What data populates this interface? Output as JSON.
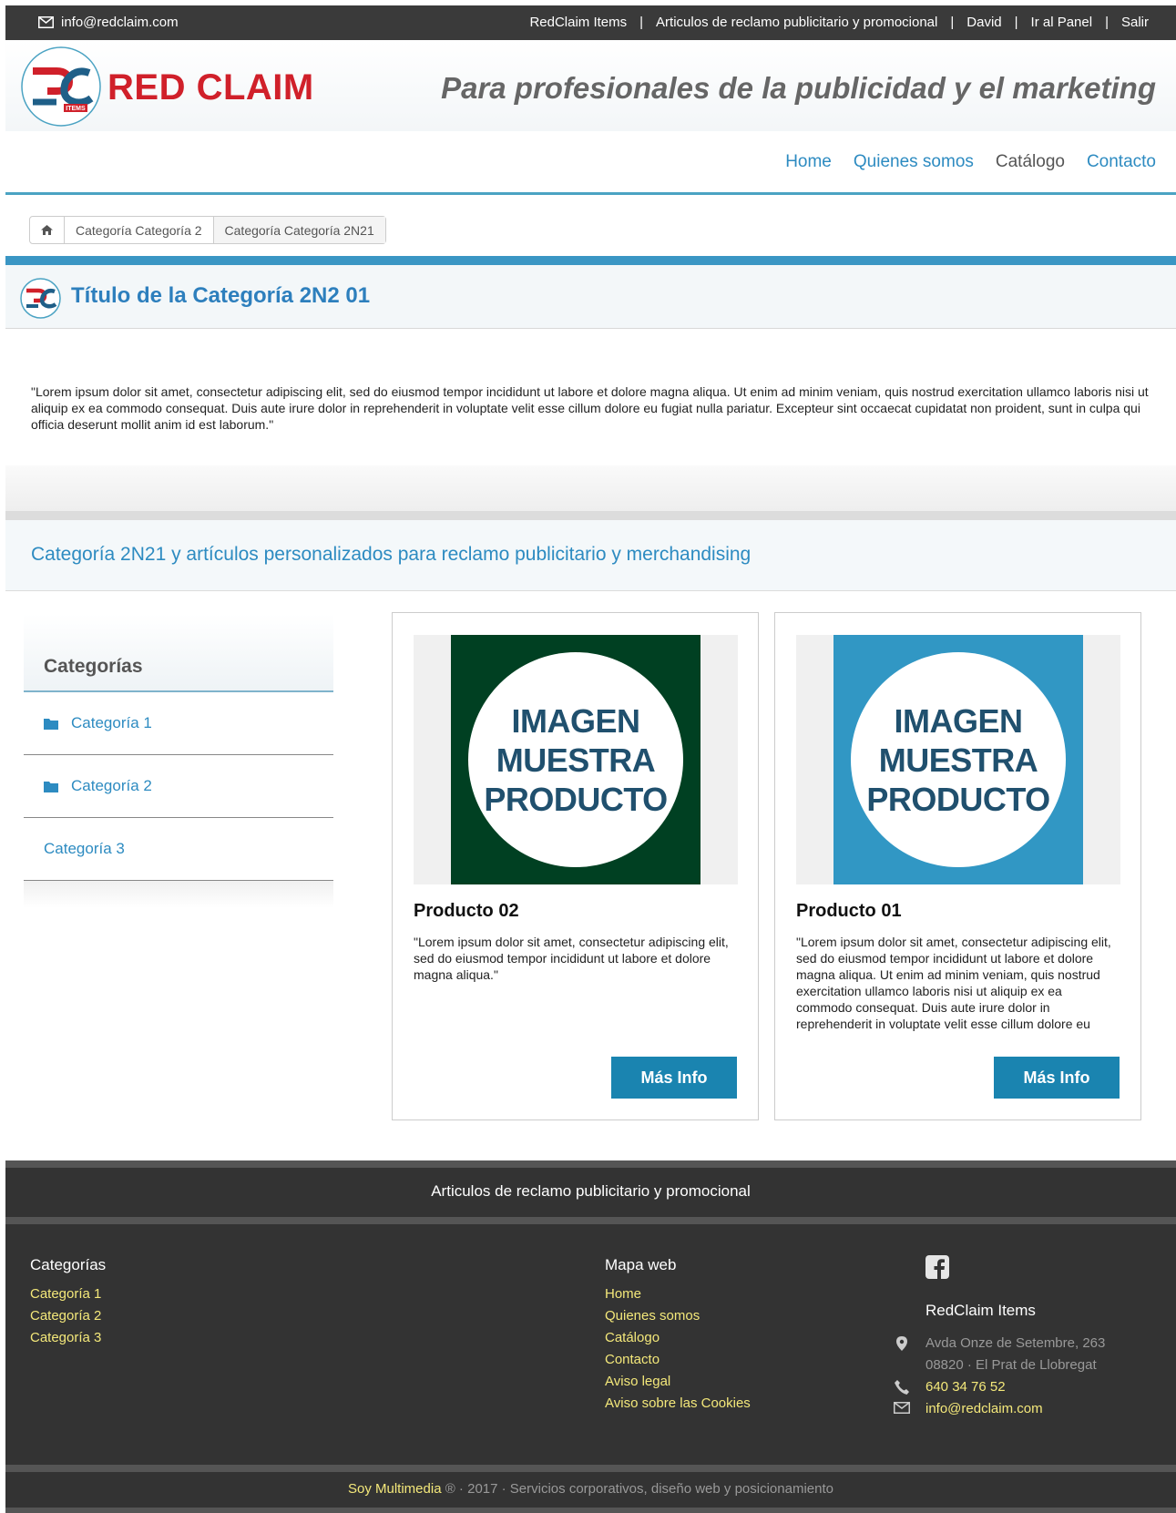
{
  "topbar": {
    "email": "info@redclaim.com",
    "links": [
      "RedClaim Items",
      "Articulos de reclamo publicitario y promocional",
      "David",
      "Ir al Panel",
      "Salir"
    ],
    "separator": "|"
  },
  "header": {
    "brand": "RED CLAIM",
    "logo_sub": "ITEMS",
    "tagline": "Para profesionales de la publicidad y el marketing"
  },
  "nav": {
    "items": [
      "Home",
      "Quienes somos",
      "Catálogo",
      "Contacto"
    ],
    "active": "Catálogo"
  },
  "breadcrumb": {
    "items": [
      "Categoría Categoría 2",
      "Categoría Categoría 2N21"
    ]
  },
  "page": {
    "title": "Título de la Categoría 2N2 01",
    "intro": "\"Lorem ipsum dolor sit amet, consectetur adipiscing elit, sed do eiusmod tempor incididunt ut labore et dolore magna aliqua. Ut enim ad minim veniam, quis nostrud exercitation ullamco laboris nisi ut aliquip ex ea commodo consequat. Duis aute irure dolor in reprehenderit in voluptate velit esse cillum dolore eu fugiat nulla pariatur. Excepteur sint occaecat cupidatat non proident, sunt in culpa qui officia deserunt mollit anim id est laborum.\"",
    "section_title": "Categoría 2N21 y artículos personalizados para reclamo publicitario y merchandising"
  },
  "sidebar": {
    "title": "Categorías",
    "items": [
      "Categoría 1",
      "Categoría 2",
      "Categoría 3"
    ]
  },
  "products": [
    {
      "name": "Producto 02",
      "image_lines": [
        "IMAGEN",
        "MUESTRA",
        "PRODUCTO"
      ],
      "image_color": "#004022",
      "description": "\"Lorem ipsum dolor sit amet, consectetur adipiscing elit, sed do eiusmod tempor incididunt ut labore et dolore magna aliqua.\"",
      "button": "Más Info"
    },
    {
      "name": "Producto 01",
      "image_lines": [
        "IMAGEN",
        "MUESTRA",
        "PRODUCTO"
      ],
      "image_color": "#3197c4",
      "description": "\"Lorem ipsum dolor sit amet, consectetur adipiscing elit, sed do eiusmod tempor incididunt ut labore et dolore magna aliqua. Ut enim ad minim veniam, quis nostrud exercitation ullamco laboris nisi ut aliquip ex ea commodo consequat. Duis aute irure dolor in reprehenderit in voluptate velit esse cillum dolore eu fugiat nulla pariatur.\"",
      "button": "Más Info"
    }
  ],
  "footer": {
    "title": "Articulos de reclamo publicitario y promocional",
    "categories_title": "Categorías",
    "categories": [
      "Categoría 1",
      "Categoría 2",
      "Categoría 3"
    ],
    "sitemap_title": "Mapa web",
    "sitemap": [
      "Home",
      "Quienes somos",
      "Catálogo",
      "Contacto",
      "Aviso legal",
      "Aviso sobre las Cookies"
    ],
    "company": "RedClaim Items",
    "address1": "Avda Onze de Setembre, 263",
    "address2": "08820 · El Prat de Llobregat",
    "phone": "640 34 76 52",
    "email": "info@redclaim.com",
    "copyright_brand": "Soy Multimedia",
    "copyright_rest": " ® · 2017 · Servicios corporativos, diseño web y posicionamiento"
  },
  "colors": {
    "accent": "#2d8bc1",
    "brand_red": "#d0202a",
    "button": "#1a84b0",
    "footer_bg": "#333333",
    "footer_link": "#f4e87a"
  }
}
